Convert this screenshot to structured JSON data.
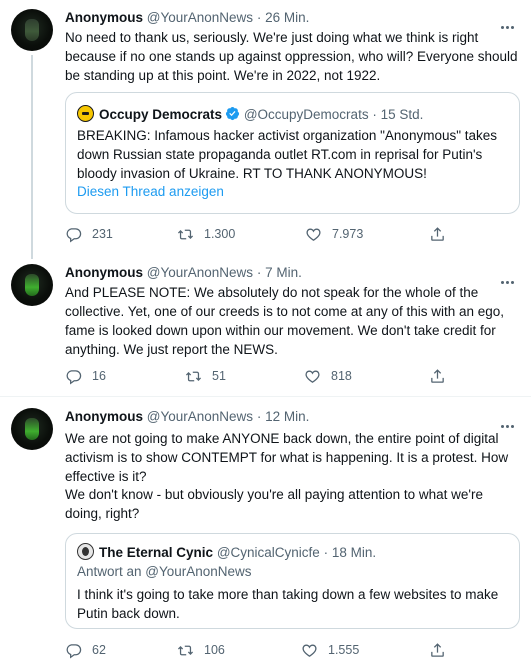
{
  "tweets": [
    {
      "name": "Anonymous",
      "handle": "@YourAnonNews",
      "sep": "·",
      "time": "26 Min.",
      "text": "No need to thank us, seriously.  We're just doing what we think is right because if no one stands up against oppression, who will?  Everyone should be standing up at this point.  We're in 2022, not 1922.",
      "quote": {
        "name": "Occupy Democrats",
        "handle": "@OccupyDemocrats",
        "time": "15 Std.",
        "text": "BREAKING: Infamous hacker activist organization \"Anonymous\" takes down Russian state propaganda outlet RT.com in reprisal for Putin's bloody invasion of Ukraine. RT TO THANK ANONYMOUS!",
        "link": "Diesen Thread anzeigen"
      },
      "replies": "231",
      "retweets": "1.300",
      "likes": "7.973"
    },
    {
      "name": "Anonymous",
      "handle": "@YourAnonNews",
      "sep": "·",
      "time": "7 Min.",
      "text": "And PLEASE NOTE: We absolutely do not speak for the whole of the collective.  Yet, one of our creeds is to not come at any of this with an ego, fame is looked down upon within our movement.  We don't take credit for anything. We just report the NEWS.",
      "replies": "16",
      "retweets": "51",
      "likes": "818"
    },
    {
      "name": "Anonymous",
      "handle": "@YourAnonNews",
      "sep": "·",
      "time": "12 Min.",
      "text": "We are not going to make ANYONE back down, the entire point of digital activism is to show CONTEMPT for what is happening.  It is a protest. How effective is it?",
      "text2": "We don't know - but obviously you're all paying attention to what we're doing, right?",
      "quote": {
        "name": "The Eternal Cynic",
        "handle": "@CynicalCynicfe",
        "time": "18 Min.",
        "reply_to": "Antwort an @YourAnonNews",
        "text": "I think it's going to take more than taking down a few websites to make Putin back down."
      },
      "replies": "62",
      "retweets": "106",
      "likes": "1.555"
    }
  ],
  "icons": {
    "avatar": "anonymous-mask-avatar",
    "more": "more-dots-icon",
    "reply": "reply-icon",
    "retweet": "retweet-icon",
    "like": "heart-icon",
    "share": "share-icon",
    "verified": "verified-badge-icon"
  },
  "colors": {
    "text": "#0f1419",
    "secondary": "#536471",
    "link": "#1d9bf0",
    "border": "#cfd9de"
  }
}
